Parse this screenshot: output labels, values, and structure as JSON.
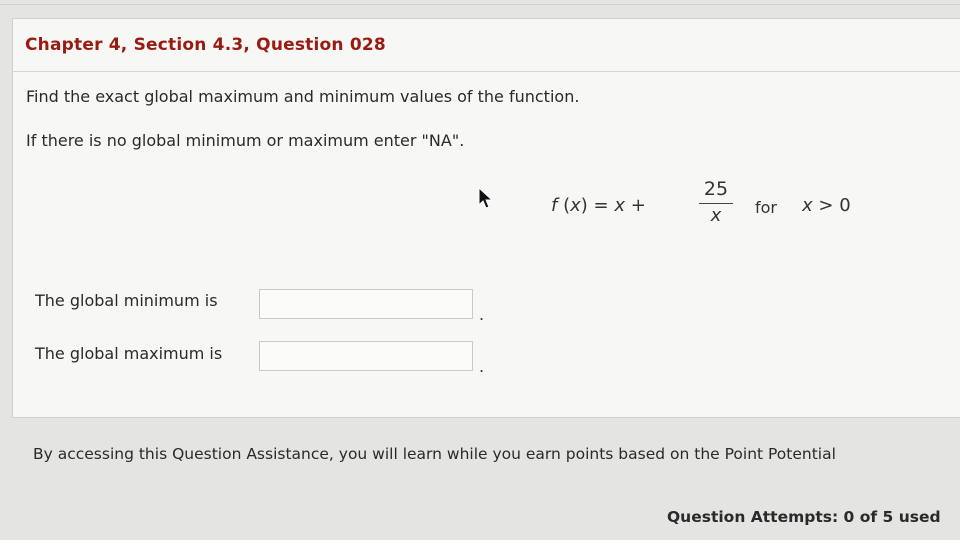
{
  "question": {
    "title": "Chapter 4, Section 4.3, Question 028",
    "instruction": "Find the exact global maximum and minimum values of the function.",
    "note": "If there is no global minimum or maximum enter \"NA\"."
  },
  "formula": {
    "lhs": "f (x) = x + ",
    "numerator": "25",
    "denominator": "x",
    "for_word": "for",
    "condition": "x > 0"
  },
  "answers": {
    "min_label": "The global minimum is",
    "min_value": "",
    "max_label": "The global maximum is",
    "max_value": "",
    "period": "."
  },
  "footer": {
    "assistance_text": "By accessing this Question Assistance, you will learn while you earn points based on the Point Potential",
    "attempts": "Question Attempts: 0 of 5 used"
  },
  "icons": {
    "pointer": "mouse-pointer-icon"
  }
}
